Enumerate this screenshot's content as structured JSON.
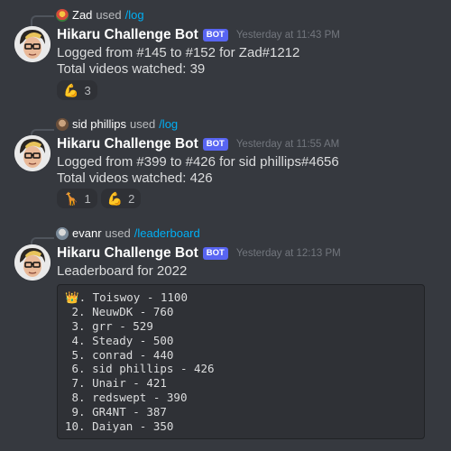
{
  "messages": [
    {
      "reply": {
        "user": "Zad",
        "used": "used",
        "command": "/log"
      },
      "author": "Hikaru Challenge Bot",
      "bot_tag": "BOT",
      "timestamp": "Yesterday at 11:43 PM",
      "lines": [
        "Logged from #145 to #152 for Zad#1212",
        "Total videos watched: 39"
      ],
      "reactions": [
        {
          "emoji": "💪",
          "icon": "flexed-biceps",
          "count": "3"
        }
      ]
    },
    {
      "reply": {
        "user": "sid phillips",
        "used": "used",
        "command": "/log"
      },
      "author": "Hikaru Challenge Bot",
      "bot_tag": "BOT",
      "timestamp": "Yesterday at 11:55 AM",
      "lines": [
        "Logged from #399 to #426 for sid phillips#4656",
        "Total videos watched: 426"
      ],
      "reactions": [
        {
          "emoji": "🦒",
          "icon": "giraffe",
          "count": "1"
        },
        {
          "emoji": "💪",
          "icon": "flexed-biceps",
          "count": "2"
        }
      ]
    },
    {
      "reply": {
        "user": "evanr",
        "used": "used",
        "command": "/leaderboard"
      },
      "author": "Hikaru Challenge Bot",
      "bot_tag": "BOT",
      "timestamp": "Yesterday at 12:13 PM",
      "lines": [
        "Leaderboard for 2022"
      ],
      "leaderboard": [
        {
          "rank": "👑.",
          "entry": "Toiswoy - 1100"
        },
        {
          "rank": " 2.",
          "entry": "NeuwDK - 760"
        },
        {
          "rank": " 3.",
          "entry": "grr - 529"
        },
        {
          "rank": " 4.",
          "entry": "Steady - 500"
        },
        {
          "rank": " 5.",
          "entry": "conrad - 440"
        },
        {
          "rank": " 6.",
          "entry": "sid phillips - 426"
        },
        {
          "rank": " 7.",
          "entry": "Unair - 421"
        },
        {
          "rank": " 8.",
          "entry": "redswept - 390"
        },
        {
          "rank": " 9.",
          "entry": "GR4NT - 387"
        },
        {
          "rank": "10.",
          "entry": "Daiyan - 350"
        }
      ]
    }
  ],
  "colors": {
    "background": "#36393f",
    "bot_tag": "#5865f2",
    "command_link": "#00aff4",
    "reaction_bg": "#2f3136",
    "code_bg": "#2f3136"
  }
}
